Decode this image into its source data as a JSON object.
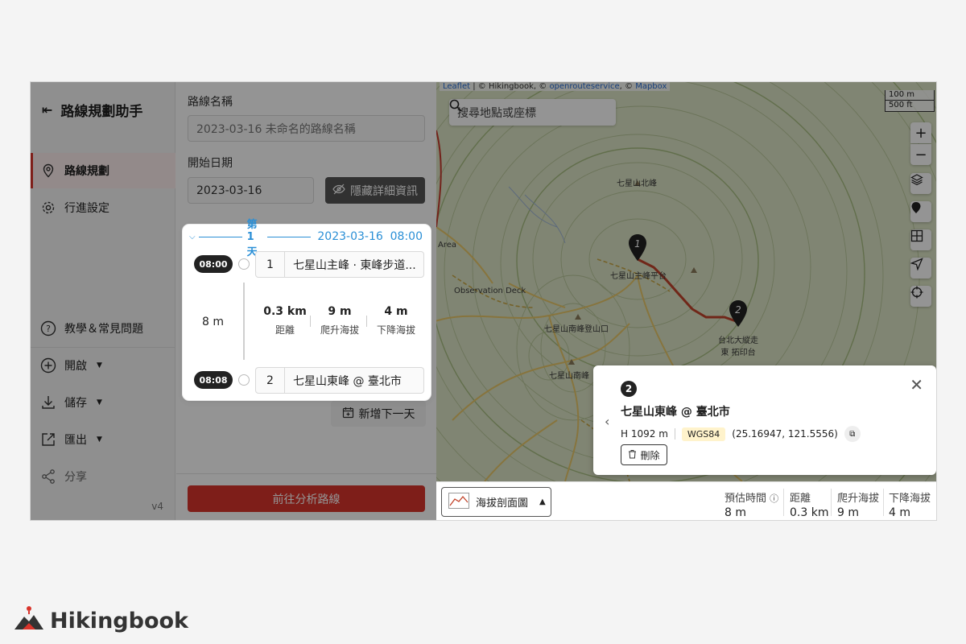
{
  "sidebar": {
    "title": "路線規劃助手",
    "nav": [
      {
        "label": "路線規劃",
        "active": true,
        "icon": "location-pin-icon"
      },
      {
        "label": "行進設定",
        "active": false,
        "icon": "gear-icon"
      }
    ],
    "help_label": "教學＆常見問題",
    "open_label": "開啟",
    "save_label": "儲存",
    "export_label": "匯出",
    "share_label": "分享",
    "version": "v4"
  },
  "panel": {
    "route_name_label": "路線名稱",
    "route_name_placeholder": "2023-03-16 未命名的路線名稱",
    "start_date_label": "開始日期",
    "start_date": "2023-03-16",
    "hide_details_label": "隱藏詳細資訊",
    "day": {
      "title": "第 1 天",
      "datetime": "2023-03-16  08:00",
      "waypoints": [
        {
          "time": "08:00",
          "num": "1",
          "name": "七星山主峰 · 東峰步道..."
        },
        {
          "time": "08:08",
          "num": "2",
          "name": "七星山東峰 @ 臺北市"
        }
      ],
      "duration": "8 m",
      "stats": [
        {
          "value": "0.3 km",
          "label": "距離"
        },
        {
          "value": "9 m",
          "label": "爬升海拔"
        },
        {
          "value": "4 m",
          "label": "下降海拔"
        }
      ]
    },
    "add_day_label": "新增下一天",
    "analyze_label": "前往分析路線"
  },
  "map": {
    "attribution_leaflet": "Leaflet",
    "attribution_rest": " | © Hikingbook, © ",
    "attribution_ors": "openrouteservice",
    "attribution_sep": ", © ",
    "attribution_mapbox": "Mapbox",
    "scale_m": "100 m",
    "scale_ft": "500 ft",
    "search_placeholder": "搜尋地點或座標",
    "labels": {
      "north_peak": "七星山北峰",
      "main_peak": "七星山主峰平台",
      "observation": "Observation Deck",
      "south_trail": "七星山南峰登山口",
      "south_peak": "七星山南峰",
      "east_peak": "台北大縱走\n東 拓印台",
      "area": "Area"
    },
    "markers": [
      "1",
      "2"
    ],
    "zoom_in": "+",
    "zoom_out": "−"
  },
  "popup": {
    "num": "2",
    "title": "七星山東峰 @ 臺北市",
    "height": "H 1092 m",
    "datum": "WGS84",
    "coords": "(25.16947, 121.5556)",
    "delete_label": "刪除"
  },
  "bottombar": {
    "profile_label": "海拔剖面圖",
    "stats": [
      {
        "label": "預估時間",
        "value": "8 m"
      },
      {
        "label": "距離",
        "value": "0.3 km"
      },
      {
        "label": "爬升海拔",
        "value": "9 m"
      },
      {
        "label": "下降海拔",
        "value": "4 m"
      }
    ]
  },
  "brand": {
    "name": "Hikingbook",
    "accent": "#d9342b"
  }
}
